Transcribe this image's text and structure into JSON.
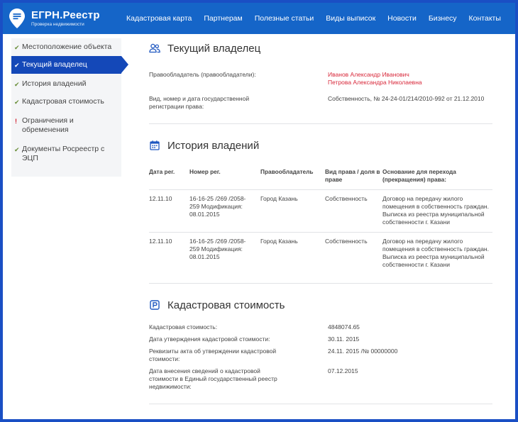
{
  "brand": {
    "title": "ЕГРН.Реестр",
    "subtitle": "Проверка недвижимости"
  },
  "nav": [
    {
      "label": "Кадастровая карта"
    },
    {
      "label": "Партнерам"
    },
    {
      "label": "Полезные статьи"
    },
    {
      "label": "Виды выписок"
    },
    {
      "label": "Новости"
    },
    {
      "label": "Бизнесу"
    },
    {
      "label": "Контакты"
    }
  ],
  "sidebar": {
    "items": [
      {
        "label": "Местоположение объекта",
        "mark": "✔"
      },
      {
        "label": "Текущий владелец",
        "mark": "✔",
        "active": true
      },
      {
        "label": "История владений",
        "mark": "✔"
      },
      {
        "label": "Кадастровая стоимость",
        "mark": "✔"
      },
      {
        "label": "Ограничения и обременения",
        "mark": "!"
      },
      {
        "label": "Документы Росреестр с ЭЦП",
        "mark": "✔"
      }
    ]
  },
  "owner": {
    "title": "Текущий владелец",
    "holder_label": "Правообладатель (правообладатели):",
    "holders": [
      "Иванов Александр Иванович",
      "Петрова Александра Николаевна"
    ],
    "reg_label": "Вид, номер и дата государственной регистрации права:",
    "reg_value": "Собственность, № 24-24-01/214/2010-992 от 21.12.2010"
  },
  "history": {
    "title": "История владений",
    "columns": [
      "Дата рег.",
      "Номер рег.",
      "Правообладатель",
      "Вид права / доля в праве",
      "Основание для перехода (прекращения) права:"
    ],
    "rows": [
      {
        "date": "12.11.10",
        "number": "16-16-25 /269 /2058-259 Модификация: 08.01.2015",
        "holder": "Город Казань",
        "right": "Собственность",
        "basis": "Договор на передачу жилого помещения в собственность граждан. Выписка из реестра муниципальной собственности г. Казани"
      },
      {
        "date": "12.11.10",
        "number": "16-16-25 /269 /2058-259 Модификация: 08.01.2015",
        "holder": "Город Казань",
        "right": "Собственность",
        "basis": "Договор на передачу жилого помещения в собственность граждан. Выписка из реестра муниципальной собственности г. Казани"
      }
    ]
  },
  "cadastral": {
    "title": "Кадастровая стоимость",
    "rows": [
      {
        "label": "Кадастровая стоимость:",
        "value": "4848074.65"
      },
      {
        "label": "Дата утверждения кадастровой стоимости:",
        "value": "30.11. 2015"
      },
      {
        "label": "Реквизиты акта об утверждении кадастровой стоимости:",
        "value": "24.11. 2015 /№ 00000000"
      },
      {
        "label": "Дата внесения сведений о кадастровой стоимости в Единый государственный реестр недвижимости:",
        "value": "07.12.2015"
      }
    ]
  },
  "colors": {
    "header": "#1565c8",
    "active": "#1448b8",
    "accent_red": "#d8283a",
    "check_green": "#6b8f3a",
    "frame": "#1a4fc4"
  },
  "icons": {
    "logo": "map-pin-menu-icon",
    "owner": "users-icon",
    "history": "calendar-icon",
    "cadastral": "parking-p-icon"
  }
}
